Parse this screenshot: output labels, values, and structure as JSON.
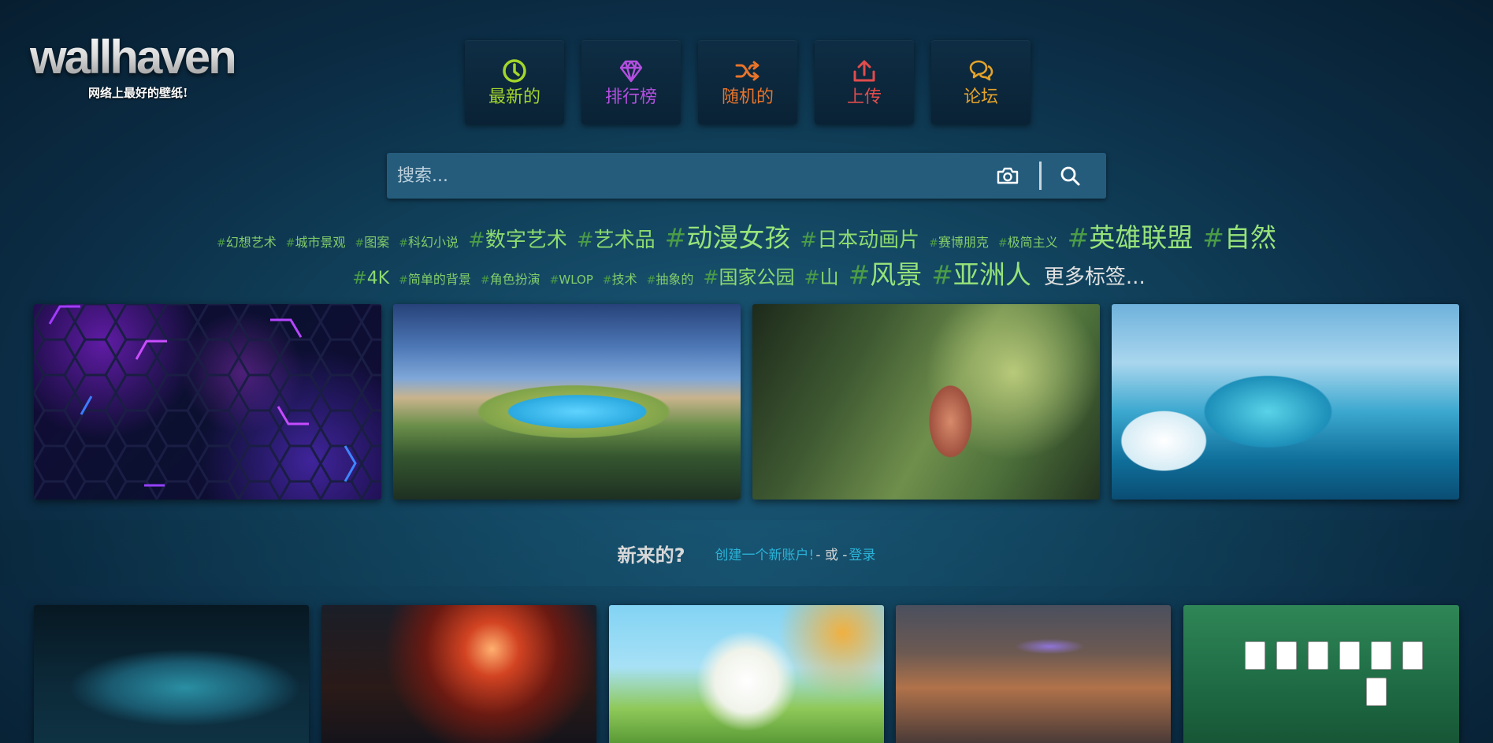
{
  "logo": {
    "title": "wallhaven",
    "tagline": "网络上最好的壁纸!"
  },
  "nav": [
    {
      "label": "最新的",
      "icon": "clock-icon",
      "color": "#a4d62b"
    },
    {
      "label": "排行榜",
      "icon": "diamond-icon",
      "color": "#b34fe0"
    },
    {
      "label": "随机的",
      "icon": "shuffle-icon",
      "color": "#e8742a"
    },
    {
      "label": "上传",
      "icon": "upload-icon",
      "color": "#e24c4c"
    },
    {
      "label": "论坛",
      "icon": "chat-icon",
      "color": "#e3a32b"
    }
  ],
  "search": {
    "placeholder": "搜索...",
    "camera_icon": "camera-icon",
    "search_icon": "search-icon"
  },
  "tags": {
    "row1": [
      "幻想艺术",
      "城市景观",
      "图案",
      "科幻小说",
      "数字艺术",
      "艺术品",
      "动漫女孩",
      "日本动画片",
      "赛博朋克",
      "极简主义",
      "英雄联盟",
      "自然"
    ],
    "row2": [
      "4K",
      "简单的背景",
      "角色扮演",
      "WLOP",
      "技术",
      "抽象的",
      "国家公园",
      "山",
      "风景",
      "亚洲人"
    ],
    "more": "更多标签..."
  },
  "join": {
    "question": "新来的?",
    "create": "创建一个新账户!",
    "or": " - 或 - ",
    "login": "登录"
  },
  "colors": {
    "tag_green": "#76c95b",
    "link_cyan": "#2bb3d8",
    "search_bg": "#255c7c"
  }
}
